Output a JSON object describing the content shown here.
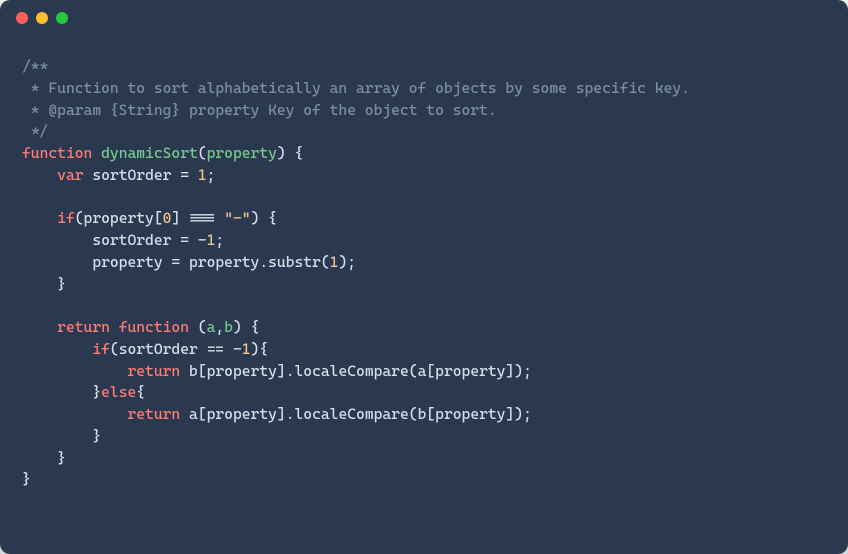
{
  "titlebar": {
    "close": "close",
    "minimize": "minimize",
    "maximize": "maximize"
  },
  "code": {
    "c1": "/**",
    "c2": " * Function to sort alphabetically an array of objects by some specific key.",
    "c3": " * @param {String} property Key of the object to sort.",
    "c4": " */",
    "kw_function": "function",
    "fn_name": "dynamicSort",
    "param_property": "property",
    "open_paren": "(",
    "close_paren": ")",
    "space": " ",
    "open_brace": "{",
    "close_brace": "}",
    "indent1": "    ",
    "indent2": "        ",
    "indent3": "            ",
    "kw_var": "var",
    "var_sortOrder": "sortOrder",
    "eq": " = ",
    "num_1": "1",
    "num_0": "0",
    "num_neg1": "1",
    "minus": "-",
    "semi": ";",
    "kw_if": "if",
    "bracket_open": "[",
    "bracket_close": "]",
    "triple_eq": " === ",
    "double_eq": " == ",
    "str_dash": "\"-\"",
    "dot": ".",
    "method_substr": "substr",
    "kw_return": "return",
    "param_a": "a",
    "param_b": "b",
    "comma": ",",
    "kw_else": "else",
    "method_localeCompare": "localeCompare"
  }
}
